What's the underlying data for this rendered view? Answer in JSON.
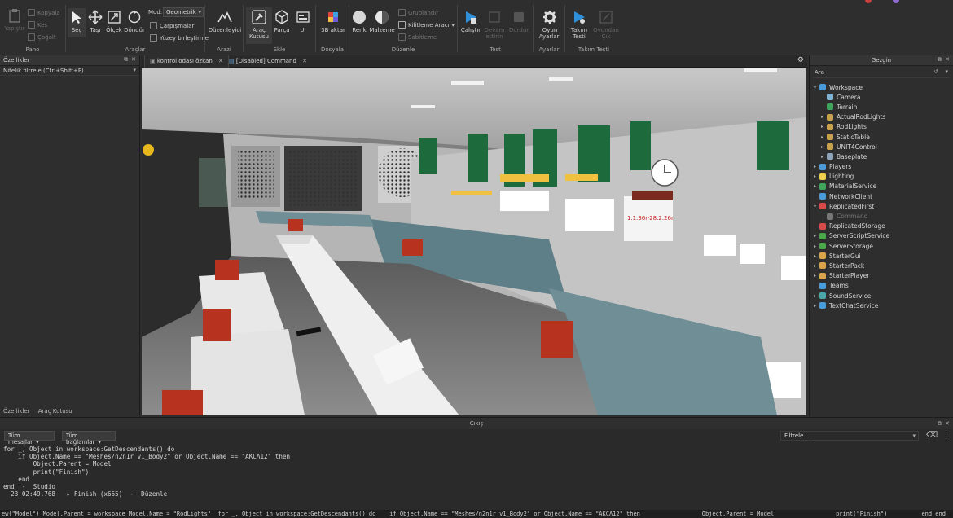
{
  "ribbon": {
    "pano": {
      "label": "Pano",
      "paste": "Yapıştır",
      "copy": "Kopyala",
      "cut": "Kes",
      "duplicate": "Çoğalt"
    },
    "araclar": {
      "label": "Araçlar",
      "select": "Seç",
      "move": "Taşı",
      "scale": "Ölçek",
      "rotate": "Döndür",
      "mode_label": "Mod:",
      "mode_value": "Geometrik",
      "collisions": "Çarpışmalar",
      "surface_join": "Yüzey birleştirme"
    },
    "arazi": {
      "label": "Arazi",
      "editor": "Düzenleyici"
    },
    "ekle": {
      "label": "Ekle",
      "toolbox_line1": "Araç",
      "toolbox_line2": "Kutusu",
      "part": "Parça",
      "ui": "UI"
    },
    "dosyala": {
      "label": "Dosyala",
      "import3d": "3B aktar"
    },
    "duzenle": {
      "label": "Düzenle",
      "color": "Renk",
      "material": "Malzeme",
      "group": "Gruplandır",
      "lock": "Kilitleme Aracı",
      "anchor": "Sabitleme"
    },
    "test": {
      "label": "Test",
      "play": "Çalıştır",
      "resume_line1": "Devam",
      "resume_line2": "ettirin",
      "stop": "Durdur"
    },
    "ayarlar": {
      "label": "Ayarlar",
      "game_settings_line1": "Oyun",
      "game_settings_line2": "Ayarları"
    },
    "takim_testi": {
      "label": "Takım Testi",
      "team_test_line1": "Takım",
      "team_test_line2": "Testi",
      "exit_line1": "Oyundan",
      "exit_line2": "Çık"
    }
  },
  "properties_panel": {
    "title": "Özellikler",
    "filter_placeholder": "Nitelik filtrele (Ctrl+Shift+P)",
    "bottom_tabs": [
      "Özellikler",
      "Araç Kutusu"
    ]
  },
  "editor_tabs": [
    {
      "label": "kontrol odası özkan"
    },
    {
      "label": "[Disabled] Command"
    }
  ],
  "explorer": {
    "title": "Gezgin",
    "search_placeholder": "Ara",
    "items": [
      {
        "label": "Workspace",
        "color": "#4a9bd9"
      },
      {
        "label": "Camera",
        "color": "#7fb3d5"
      },
      {
        "label": "Terrain",
        "color": "#3fa55a"
      },
      {
        "label": "ActualRodLights",
        "color": "#c9a24b"
      },
      {
        "label": "RodLights",
        "color": "#c9a24b"
      },
      {
        "label": "StaticTable",
        "color": "#c9a24b"
      },
      {
        "label": "UNIT4Control",
        "color": "#c9a24b"
      },
      {
        "label": "Baseplate",
        "color": "#8fa4b8"
      },
      {
        "label": "Players",
        "color": "#4a9bd9"
      },
      {
        "label": "Lighting",
        "color": "#f0d04a"
      },
      {
        "label": "MaterialService",
        "color": "#3fa55a"
      },
      {
        "label": "NetworkClient",
        "color": "#4a9bd9"
      },
      {
        "label": "ReplicatedFirst",
        "color": "#d94a4a"
      },
      {
        "label": "Command",
        "color": "#777777"
      },
      {
        "label": "ReplicatedStorage",
        "color": "#d94a4a"
      },
      {
        "label": "ServerScriptService",
        "color": "#4aa84a"
      },
      {
        "label": "ServerStorage",
        "color": "#4aa84a"
      },
      {
        "label": "StarterGui",
        "color": "#d9a44a"
      },
      {
        "label": "StarterPack",
        "color": "#d9a44a"
      },
      {
        "label": "StarterPlayer",
        "color": "#d9a44a"
      },
      {
        "label": "Teams",
        "color": "#4a9bd9"
      },
      {
        "label": "SoundService",
        "color": "#4aa8a8"
      },
      {
        "label": "TextChatService",
        "color": "#4a9bd9"
      }
    ]
  },
  "output": {
    "title": "Çıkış",
    "messages_filter": "Tüm mesajlar",
    "contexts_filter": "Tüm bağlamlar",
    "filter_placeholder": "Filtrele...",
    "lines": [
      "for _, Object in workspace:GetDescendants() do",
      "    if Object.Name == \"Meshes/n2n1r v1_Body2\" or Object.Name == \"AKCΛ12\" then",
      "        Object.Parent = Model",
      "        print(\"Finish\")",
      "    end",
      "end  -  Studio",
      "  23:02:49.768   ▸ Finish (x655)  -  Düzenle"
    ],
    "command_bar": "ew(\"Model\") Model.Parent = workspace Model.Name = \"RodLights\"  for _, Object in workspace:GetDescendants() do    if Object.Name == \"Meshes/n2n1r v1_Body2\" or Object.Name == \"AKCΛ12\" then                  Object.Parent = Model                  print(\"Finish\")          end end"
  },
  "viewport": {
    "clock_text": "1.1.36r-28.2.26r"
  }
}
